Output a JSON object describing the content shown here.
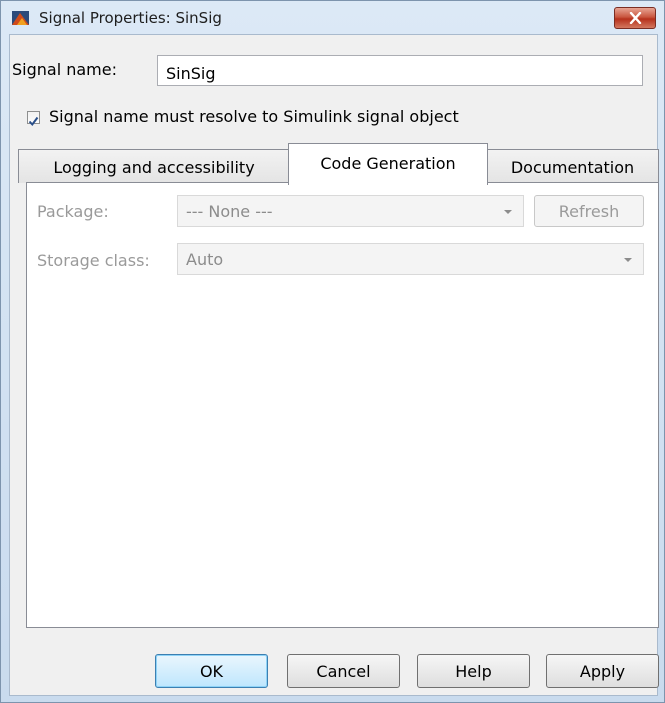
{
  "window": {
    "title": "Signal Properties: SinSig"
  },
  "signal": {
    "name_label": "Signal name:",
    "name_value": "SinSig",
    "resolve_checked": true,
    "resolve_label": "Signal name must resolve to Simulink signal object"
  },
  "tabs": [
    {
      "label": "Logging and accessibility",
      "active": false
    },
    {
      "label": "Code Generation",
      "active": true
    },
    {
      "label": "Documentation",
      "active": false
    }
  ],
  "code_generation": {
    "package_label": "Package:",
    "package_value": "--- None ---",
    "refresh_label": "Refresh",
    "storage_class_label": "Storage class:",
    "storage_class_value": "Auto"
  },
  "buttons": {
    "ok": "OK",
    "cancel": "Cancel",
    "help": "Help",
    "apply": "Apply"
  },
  "colors": {
    "title_bar": "#dce9f6",
    "close_button": "#c9563f",
    "checkbox_check": "#2a4f8a"
  }
}
